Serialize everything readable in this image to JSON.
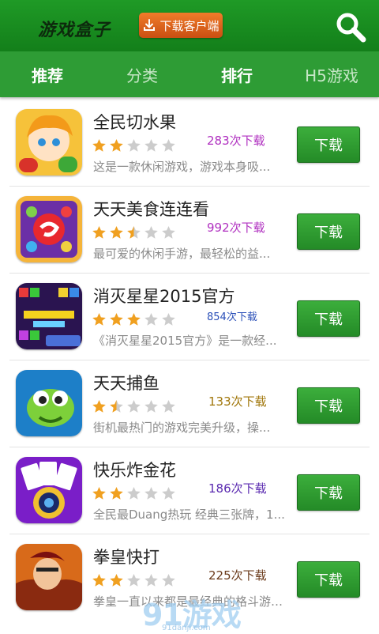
{
  "header": {
    "app_title": "游戏盒子",
    "download_client_label": "下载客户端"
  },
  "tabs": [
    {
      "label": "推荐",
      "active": true
    },
    {
      "label": "分类",
      "active": false
    },
    {
      "label": "排行",
      "active": true
    },
    {
      "label": "H5游戏",
      "active": false
    }
  ],
  "games": [
    {
      "name": "全民切水果",
      "rating": 2,
      "downloads": "283次下载",
      "count_color": "#b030c0",
      "description": "这是一款休闲游戏，游戏本身吸...",
      "button": "下载"
    },
    {
      "name": "天天美食连连看",
      "rating": 2.5,
      "downloads": "992次下载",
      "count_color": "#b030c0",
      "description": "最可爱的休闲手游，最轻松的益...",
      "button": "下载"
    },
    {
      "name": "消灭星星2015官方",
      "rating": 3,
      "downloads": "854次下载",
      "count_color": "#2a4fb8",
      "description": "《消灭星星2015官方》是一款经...",
      "button": "下载"
    },
    {
      "name": "天天捕鱼",
      "rating": 1.5,
      "downloads": "133次下载",
      "count_color": "#a0760a",
      "description": "街机最热门的游戏完美升级，操...",
      "button": "下载"
    },
    {
      "name": "快乐炸金花",
      "rating": 2,
      "downloads": "186次下载",
      "count_color": "#5a2ab0",
      "description": "全民最Duang热玩 经典三张牌，1...",
      "button": "下载"
    },
    {
      "name": "拳皇快打",
      "rating": 2,
      "downloads": "225次下载",
      "count_color": "#6a3a1a",
      "description": "拳皇一直以来都是最经典的格斗游戏...",
      "button": "下载"
    }
  ],
  "watermark": {
    "brand": "91游戏",
    "site": "91danji.com"
  },
  "colors": {
    "header_green": "#1a8f21",
    "tab_bar_green": "#2e9c35",
    "button_green": "#2f9e32",
    "client_button_orange": "#e0641e",
    "star_orange": "#f0a020",
    "star_gray": "#cccccc"
  }
}
